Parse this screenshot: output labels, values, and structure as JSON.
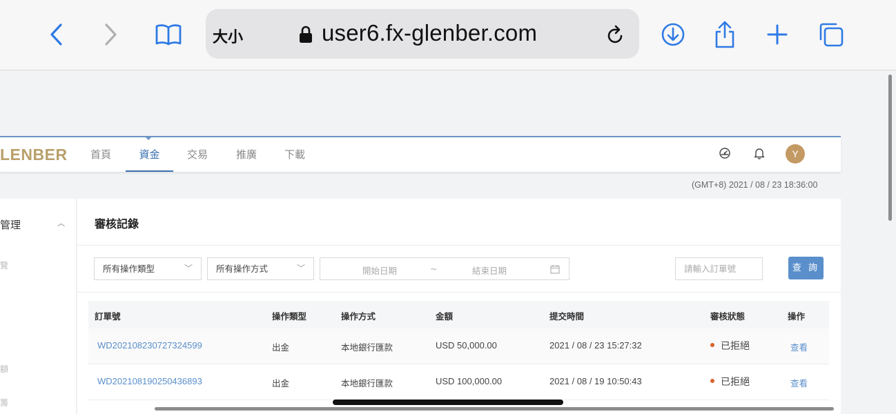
{
  "browser": {
    "text_size_label": "大小",
    "url": "user6.fx-glenber.com"
  },
  "nav": {
    "brand": "LENBER",
    "items": [
      "首頁",
      "資金",
      "交易",
      "推廣",
      "下載"
    ],
    "active_index": 1,
    "avatar_letter": "Y"
  },
  "timestamp": "(GMT+8) 2021 / 08 / 23 18:36:00",
  "sidebar": {
    "title": "管理",
    "subitems": [
      "覽",
      "額",
      "籌"
    ]
  },
  "main": {
    "title": "審核記錄",
    "filters": {
      "type_select": "所有操作類型",
      "method_select": "所有操作方式",
      "start_date_placeholder": "開始日期",
      "date_separator": "~",
      "end_date_placeholder": "結束日期",
      "order_placeholder": "請輸入訂單號",
      "query_button": "查 詢"
    },
    "table": {
      "headers": [
        "訂單號",
        "操作類型",
        "操作方式",
        "金額",
        "提交時間",
        "審核狀態",
        "操作"
      ],
      "rows": [
        {
          "order_no": "WD202108230727324599",
          "type": "出金",
          "method": "本地銀行匯款",
          "amount": "USD 50,000.00",
          "submitted": "2021 / 08 / 23 15:27:32",
          "status": "已拒絕",
          "action": "查看"
        },
        {
          "order_no": "WD202108190250436893",
          "type": "出金",
          "method": "本地銀行匯款",
          "amount": "USD 100,000.00",
          "submitted": "2021 / 08 / 19 10:50:43",
          "status": "已拒絕",
          "action": "查看"
        }
      ]
    }
  },
  "colors": {
    "accent": "#3a6fb0",
    "button": "#5a8fcb",
    "brand_gold": "#b9a06a",
    "status_rejected": "#d9622b",
    "safari_blue": "#2f7ae5"
  }
}
